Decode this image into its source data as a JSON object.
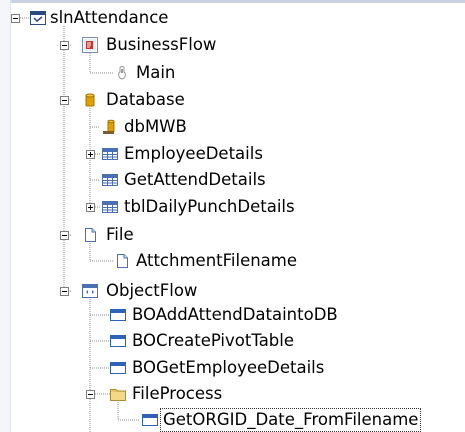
{
  "tree": {
    "root": {
      "label": "slnAttendance",
      "icon": "solution-icon"
    },
    "business_flow": {
      "label": "BusinessFlow",
      "icon": "business-flow-icon"
    },
    "main": {
      "label": "Main",
      "icon": "flow-start-icon"
    },
    "database": {
      "label": "Database",
      "icon": "database-icon"
    },
    "db_mwb": {
      "label": "dbMWB",
      "icon": "db-connection-icon"
    },
    "employee_details": {
      "label": "EmployeeDetails",
      "icon": "table-icon"
    },
    "get_attend_details": {
      "label": "GetAttendDetails",
      "icon": "table-icon"
    },
    "tbl_daily_punch_details": {
      "label": "tblDailyPunchDetails",
      "icon": "table-icon"
    },
    "file": {
      "label": "File",
      "icon": "file-icon"
    },
    "attchment_filename": {
      "label": "AttchmentFilename",
      "icon": "file-icon"
    },
    "object_flow": {
      "label": "ObjectFlow",
      "icon": "object-flow-icon"
    },
    "bo_add_attend": {
      "label": "BOAddAttendDataintoDB",
      "icon": "business-object-icon"
    },
    "bo_create_pivot": {
      "label": "BOCreatePivotTable",
      "icon": "business-object-icon"
    },
    "bo_get_employee": {
      "label": "BOGetEmployeeDetails",
      "icon": "business-object-icon"
    },
    "file_process": {
      "label": "FileProcess",
      "icon": "folder-icon"
    },
    "get_orgid": {
      "label": "GetORGID_Date_FromFilename",
      "icon": "business-object-icon"
    }
  },
  "colors": {
    "connector": "#8c8c8c",
    "table_blue": "#4a6fb5",
    "folder_yellow": "#e8c56a",
    "database_gold": "#e0a100",
    "business_flow_red": "#c0392b"
  }
}
